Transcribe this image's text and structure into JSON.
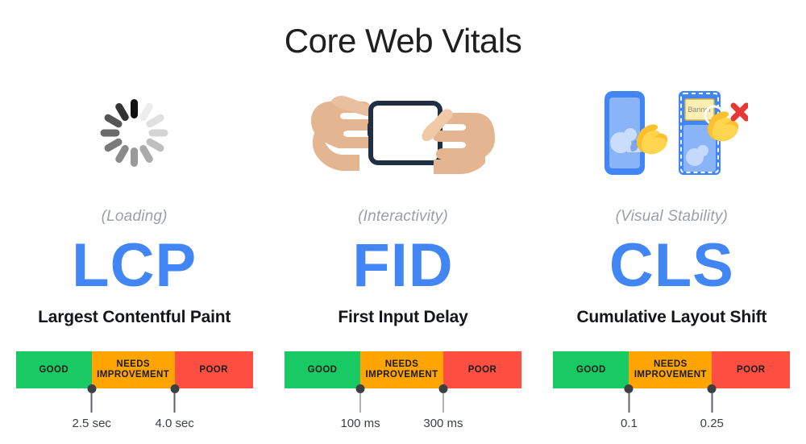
{
  "header": {
    "title": "Core Web Vitals"
  },
  "colors": {
    "accent_blue": "#4285F4",
    "good": "#18C964",
    "needs_improvement": "#FFA400",
    "poor": "#FF4E42",
    "subtitle_gray": "#9AA0A6",
    "label_dark": "#3C4043"
  },
  "bar_labels": {
    "good": "GOOD",
    "needs_improvement": "NEEDS IMPROVEMENT",
    "poor": "POOR"
  },
  "metrics": [
    {
      "icon": "loading-spinner-icon",
      "subtitle": "(Loading)",
      "acronym": "LCP",
      "fullname": "Largest Contentful Paint",
      "thresholds": [
        {
          "label": "2.5 sec",
          "position_pct": 32
        },
        {
          "label": "4.0 sec",
          "position_pct": 67
        }
      ]
    },
    {
      "icon": "hands-tapping-phone-icon",
      "subtitle": "(Interactivity)",
      "acronym": "FID",
      "fullname": "First Input Delay",
      "thresholds": [
        {
          "label": "100 ms",
          "position_pct": 32
        },
        {
          "label": "300 ms",
          "position_pct": 67
        }
      ]
    },
    {
      "icon": "layout-shift-banner-icon",
      "subtitle": "(Visual Stability)",
      "acronym": "CLS",
      "fullname": "Cumulative Layout Shift",
      "thresholds": [
        {
          "label": "0.1",
          "position_pct": 32
        },
        {
          "label": "0.25",
          "position_pct": 67
        }
      ]
    }
  ],
  "cls_art": {
    "banner_label": "Banner"
  }
}
